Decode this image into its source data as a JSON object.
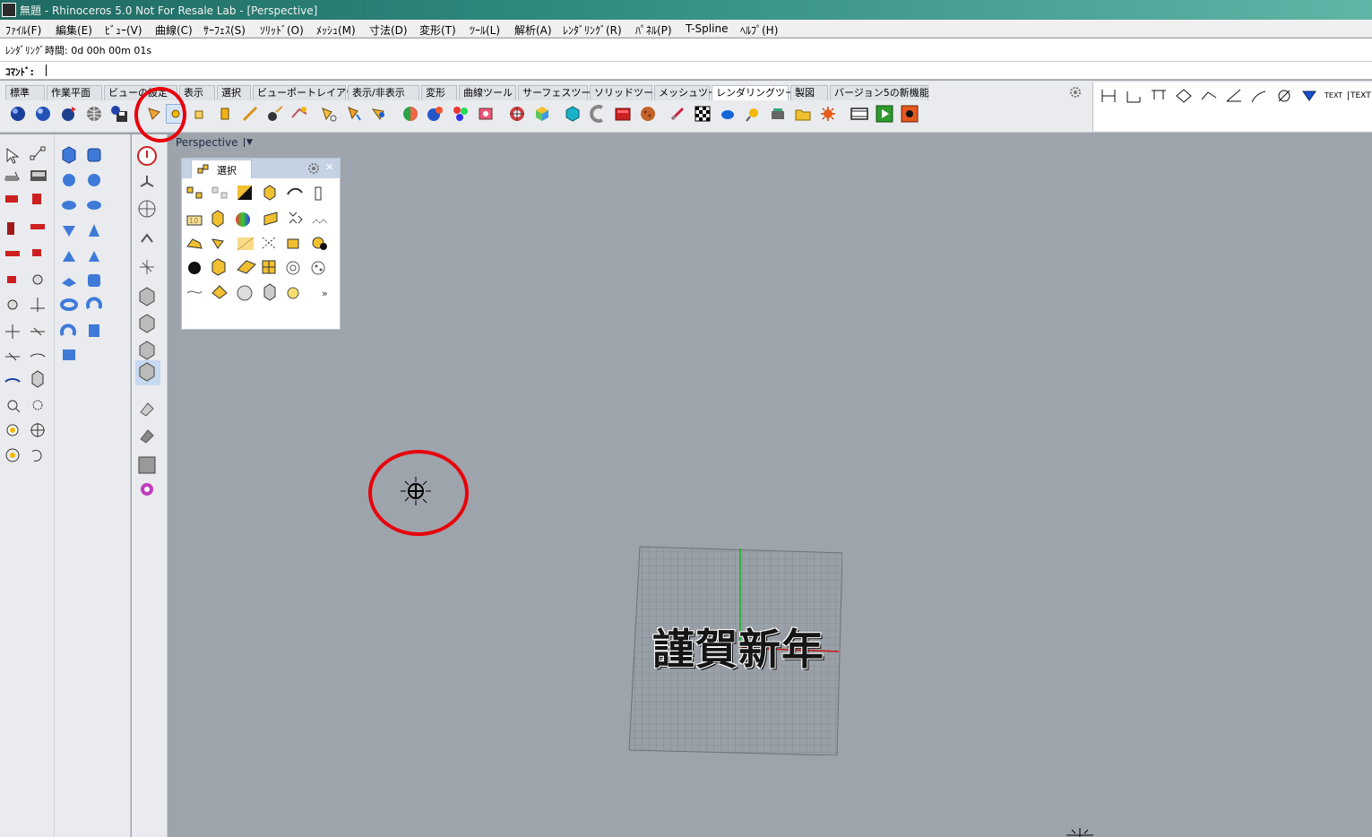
{
  "window": {
    "title": "無題 - Rhinoceros 5.0 Not For Resale Lab - [Perspective]"
  },
  "menu": [
    "ﾌｧｲﾙ(F)",
    "編集(E)",
    "ﾋﾞｭｰ(V)",
    "曲線(C)",
    "ｻｰﾌｪｽ(S)",
    "ｿﾘｯﾄﾞ(O)",
    "ﾒｯｼｭ(M)",
    "寸法(D)",
    "変形(T)",
    "ﾂｰﾙ(L)",
    "解析(A)",
    "ﾚﾝﾀﾞﾘﾝｸﾞ(R)",
    "ﾊﾟﾈﾙ(P)",
    "T-Spline",
    "ﾍﾙﾌﾟ(H)"
  ],
  "history": {
    "text": "ﾚﾝﾀﾞﾘﾝｸﾞ時間: 0d 00h 00m 01s"
  },
  "command": {
    "label": "ｺﾏﾝﾄﾞ:",
    "value": ""
  },
  "tabs": [
    {
      "label": "標準",
      "active": false
    },
    {
      "label": "作業平面",
      "active": false
    },
    {
      "label": "ビューの設定",
      "active": false
    },
    {
      "label": "表示",
      "active": false
    },
    {
      "label": "選択",
      "active": false
    },
    {
      "label": "ビューポートレイアウト",
      "active": false
    },
    {
      "label": "表示/非表示",
      "active": false
    },
    {
      "label": "変形",
      "active": false
    },
    {
      "label": "曲線ツール",
      "active": false
    },
    {
      "label": "サーフェスツール",
      "active": false
    },
    {
      "label": "ソリッドツール",
      "active": false
    },
    {
      "label": "メッシュツール",
      "active": false
    },
    {
      "label": "レンダリングツール",
      "active": true
    },
    {
      "label": "製図",
      "active": false
    },
    {
      "label": "バージョン5の新機能",
      "active": false
    }
  ],
  "right_dock": {
    "text_label_1": "TEXT",
    "text_label_2": "TEXT"
  },
  "viewport": {
    "name": "Perspective"
  },
  "selection_panel": {
    "title": "選択",
    "ten_label": "10",
    "more_label": "»"
  },
  "scene": {
    "text_object": "謹賀新年"
  },
  "colors": {
    "highlight_ring": "#e8000a",
    "viewport_bg": "#9ea4ab",
    "title_bar": "#2f8a7e"
  }
}
